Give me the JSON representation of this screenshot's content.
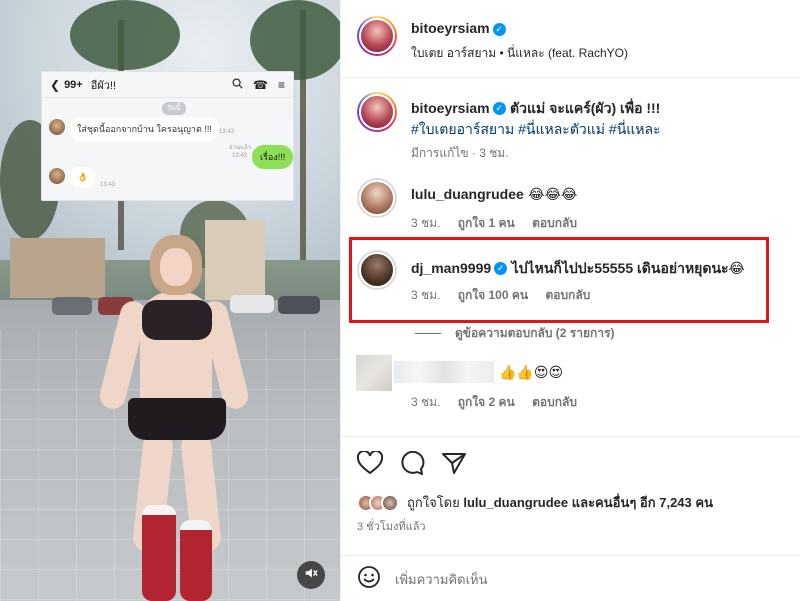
{
  "post": {
    "username": "bitoeyrsiam",
    "music": "ใบเตย อาร์สยาม • นี่แหละ (feat. RachYO)"
  },
  "chat_overlay": {
    "count": "99+",
    "name": "อีผัว!!",
    "day": "วันนี้",
    "msg1": "ใส่ชุดนี้ออกจากบ้าน ใครอนุญาต !!!",
    "msg1_time": "13:43",
    "read_label": "อ่านแล้ว",
    "msg2": "เรื่อง!!!",
    "msg2_time": "13:43",
    "msg3": "👌",
    "msg3_time": "13:43"
  },
  "comments": [
    {
      "username": "bitoeyrsiam",
      "text": "ตัวแม่ จะแคร์(ผัว) เพื่อ !!!",
      "hashtags": "#ใบเตยอาร์สยาม #นี่แหละตัวแม่ #นี่แหละ",
      "meta": "มีการแก้ไข · 3 ชม."
    },
    {
      "username": "lulu_duangrudee",
      "text": "😂😂😂",
      "time": "3 ชม.",
      "likes": "ถูกใจ 1 คน",
      "reply": "ตอบกลับ"
    },
    {
      "username": "dj_man9999",
      "text": "ไปไหนก็ไปปะ55555 เดินอย่าหยุดนะ😂",
      "time": "3 ชม.",
      "likes": "ถูกใจ 100 คน",
      "reply": "ตอบกลับ"
    },
    {
      "username": "",
      "text": "👍👍😍😍",
      "time": "3 ชม.",
      "likes": "ถูกใจ 2 คน",
      "reply": "ตอบกลับ"
    }
  ],
  "replies_toggle": "ดูข้อความตอบกลับ (2 รายการ)",
  "likes_summary": {
    "prefix": "ถูกใจโดย",
    "user": "lulu_duangrudee",
    "suffix": "และคนอื่นๆ อีก 7,243 คน"
  },
  "time_ago": "3 ชั่วโมงที่แล้ว",
  "add_comment_placeholder": "เพิ่มความคิดเห็น"
}
